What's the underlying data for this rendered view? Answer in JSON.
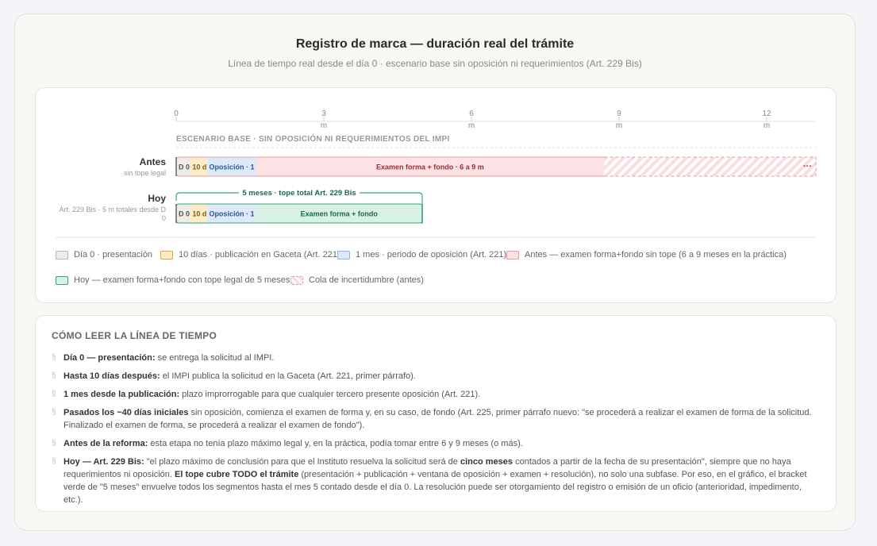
{
  "header": {
    "title": "Registro de marca — duración real del trámite",
    "subtitle": "Línea de tiempo real desde el día 0 · escenario base sin oposición ni requerimientos (Art. 229 Bis)"
  },
  "chart_data": {
    "type": "timeline",
    "x_unit": "m",
    "xlim": [
      0,
      13
    ],
    "ticks": [
      0,
      3,
      6,
      9,
      12
    ],
    "section_label": "ESCENARIO BASE · SIN OPOSICIÓN NI REQUERIMIENTOS DEL IMPI",
    "rows": [
      {
        "name": "Antes",
        "sub": "sin tope legal",
        "segments": [
          {
            "label": "D 0",
            "start": 0,
            "end": 0.28,
            "kind": "dia0"
          },
          {
            "label": "10 d",
            "start": 0.28,
            "end": 0.62,
            "kind": "gaceta"
          },
          {
            "label": "Oposición · 1 m",
            "start": 0.62,
            "end": 1.62,
            "kind": "oposicion"
          },
          {
            "label": "Examen forma + fondo · 6 a 9 m",
            "start": 1.62,
            "end": 8.7,
            "kind": "antes"
          },
          {
            "label": "",
            "start": 8.7,
            "end": 13,
            "kind": "cola"
          }
        ],
        "more_label": "···"
      },
      {
        "name": "Hoy",
        "sub": "Art. 229 Bis · 5 m totales desde D 0",
        "segments": [
          {
            "label": "D 0",
            "start": 0,
            "end": 0.28,
            "kind": "dia0"
          },
          {
            "label": "10 d",
            "start": 0.28,
            "end": 0.62,
            "kind": "gaceta"
          },
          {
            "label": "Oposición · 1 m",
            "start": 0.62,
            "end": 1.62,
            "kind": "oposicion"
          },
          {
            "label": "Examen forma + fondo",
            "start": 1.62,
            "end": 5,
            "kind": "hoy"
          }
        ],
        "bracket": {
          "start": 0,
          "end": 5,
          "label": "5 meses · tope total Art. 229 Bis"
        }
      }
    ],
    "legend": [
      {
        "label": "Día 0 · presentación",
        "kind": "dia0"
      },
      {
        "label": "10 días · publicación en Gaceta (Art. 221)",
        "kind": "gaceta"
      },
      {
        "label": "1 mes · periodo de oposición (Art. 221)",
        "kind": "oposicion"
      },
      {
        "label": "Antes — examen forma+fondo sin tope (6 a 9 meses en la práctica)",
        "kind": "antes"
      },
      {
        "label": "Hoy — examen forma+fondo con tope legal de 5 meses",
        "kind": "hoy"
      },
      {
        "label": "Cola de incertidumbre (antes)",
        "kind": "cola"
      }
    ],
    "colors": {
      "dia0": {
        "fill": "#eeece7",
        "stroke": "#b9b5ab",
        "text": "#555555"
      },
      "gaceta": {
        "fill": "#fcecc8",
        "stroke": "#e2a23a",
        "text": "#8a5a10"
      },
      "oposicion": {
        "fill": "#dde9f7",
        "stroke": "#8fb3dc",
        "text": "#2c5c92"
      },
      "antes": {
        "fill": "#fbe3e5",
        "stroke": "#e79aa1",
        "text": "#9a2d37"
      },
      "hoy": {
        "fill": "#d8f1e4",
        "stroke": "#3aa674",
        "text": "#1d6a44"
      },
      "cola": {
        "fill": "#f9dde0",
        "stroke": "#e79aa1",
        "text": "#9a2d37"
      }
    }
  },
  "howto": {
    "title": "CÓMO LEER LA LÍNEA DE TIEMPO",
    "marker": "§",
    "items": [
      {
        "bold": "Día 0 — presentación:",
        "text": " se entrega la solicitud al IMPI."
      },
      {
        "bold": "Hasta 10 días después:",
        "text": " el IMPI publica la solicitud en la Gaceta (Art. 221, primer párrafo)."
      },
      {
        "bold": "1 mes desde la publicación:",
        "text": " plazo improrrogable para que cualquier tercero presente oposición (Art. 221)."
      },
      {
        "bold": "Pasados los ~40 días iniciales",
        "text": " sin oposición, comienza el examen de forma y, en su caso, de fondo (Art. 225, primer párrafo nuevo: \"se procederá a realizar el examen de forma de la solicitud. Finalizado el examen de forma, se procederá a realizar el examen de fondo\")."
      },
      {
        "bold": "Antes de la reforma:",
        "text": " esta etapa no tenía plazo máximo legal y, en la práctica, podía tomar entre 6 y 9 meses (o más)."
      }
    ],
    "last": {
      "b1": "Hoy — Art. 229 Bis:",
      "t1": " \"el plazo máximo de conclusión para que el Instituto resuelva la solicitud será de ",
      "b2": "cinco meses",
      "t2": " contados a partir de la fecha de su presentación\", siempre que no haya requerimientos ni oposición. ",
      "b3": "El tope cubre TODO el trámite",
      "t3": " (presentación + publicación + ventana de oposición + examen + resolución), no solo una subfase. Por eso, en el gráfico, el bracket verde de \"5 meses\" envuelve todos los segmentos hasta el mes 5 contado desde el día 0. La resolución puede ser otorgamiento del registro o emisión de un oficio (anterioridad, impedimento, etc.)."
    }
  }
}
